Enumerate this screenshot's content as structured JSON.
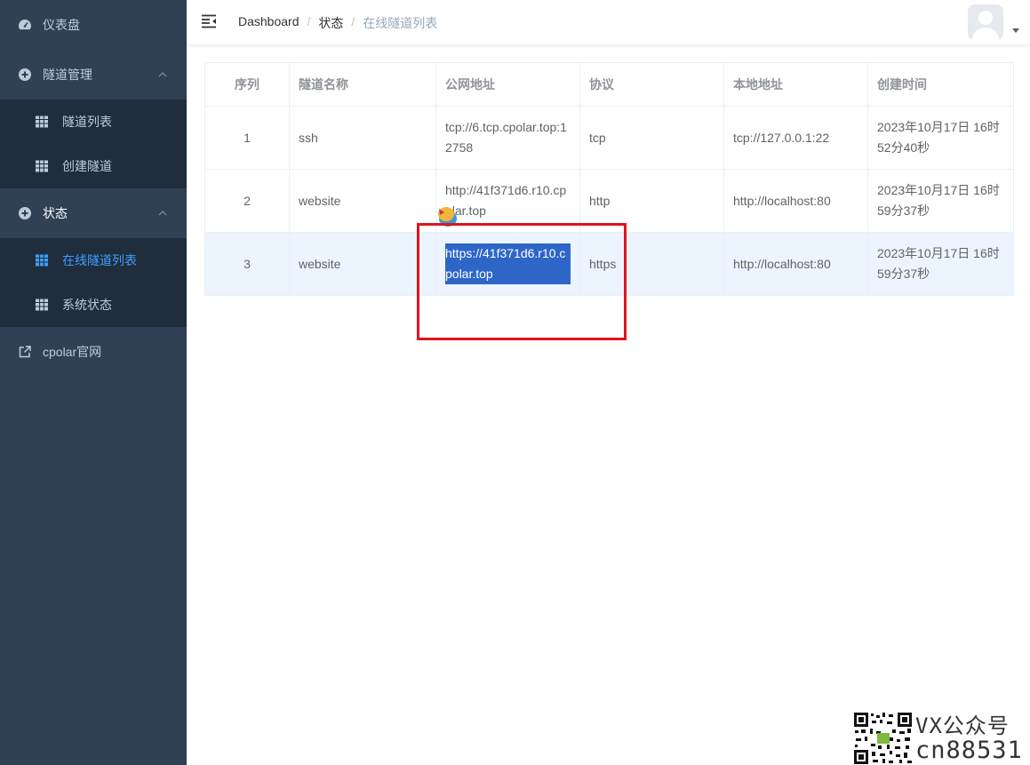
{
  "sidebar": {
    "items": [
      {
        "label": "仪表盘",
        "icon": "dashboard-icon"
      },
      {
        "label": "隧道管理",
        "icon": "plus-circle-icon",
        "expanded": true,
        "children": [
          {
            "label": "隧道列表",
            "icon": "table-icon"
          },
          {
            "label": "创建隧道",
            "icon": "table-icon"
          }
        ]
      },
      {
        "label": "状态",
        "icon": "plus-circle-icon",
        "expanded": true,
        "children": [
          {
            "label": "在线隧道列表",
            "icon": "table-icon",
            "active": true
          },
          {
            "label": "系统状态",
            "icon": "table-icon"
          }
        ]
      },
      {
        "label": "cpolar官网",
        "icon": "external-link-icon"
      }
    ]
  },
  "navbar": {
    "breadcrumb": [
      "Dashboard",
      "状态",
      "在线隧道列表"
    ]
  },
  "table": {
    "columns": [
      "序列",
      "隧道名称",
      "公网地址",
      "协议",
      "本地地址",
      "创建时间"
    ],
    "rows": [
      {
        "index": "1",
        "name": "ssh",
        "public_url": "tcp://6.tcp.cpolar.top:12758",
        "protocol": "tcp",
        "local": "tcp://127.0.0.1:22",
        "created": "2023年10月17日 16时52分40秒"
      },
      {
        "index": "2",
        "name": "website",
        "public_url": "http://41f371d6.r10.cpolar.top",
        "protocol": "http",
        "local": "http://localhost:80",
        "created": "2023年10月17日 16时59分37秒"
      },
      {
        "index": "3",
        "name": "website",
        "public_url": "https://41f371d6.r10.cpolar.top",
        "protocol": "https",
        "local": "http://localhost:80",
        "created": "2023年10月17日 16时59分37秒"
      }
    ],
    "highlight_row": 3
  },
  "colors": {
    "sidebar_bg": "#304156",
    "submenu_bg": "#1f2d3d",
    "active": "#409eff",
    "selection": "#2e66c8",
    "annotation_red": "#e0141e"
  },
  "watermark": {
    "line1": "VX公众号",
    "line2": "cn88531"
  }
}
